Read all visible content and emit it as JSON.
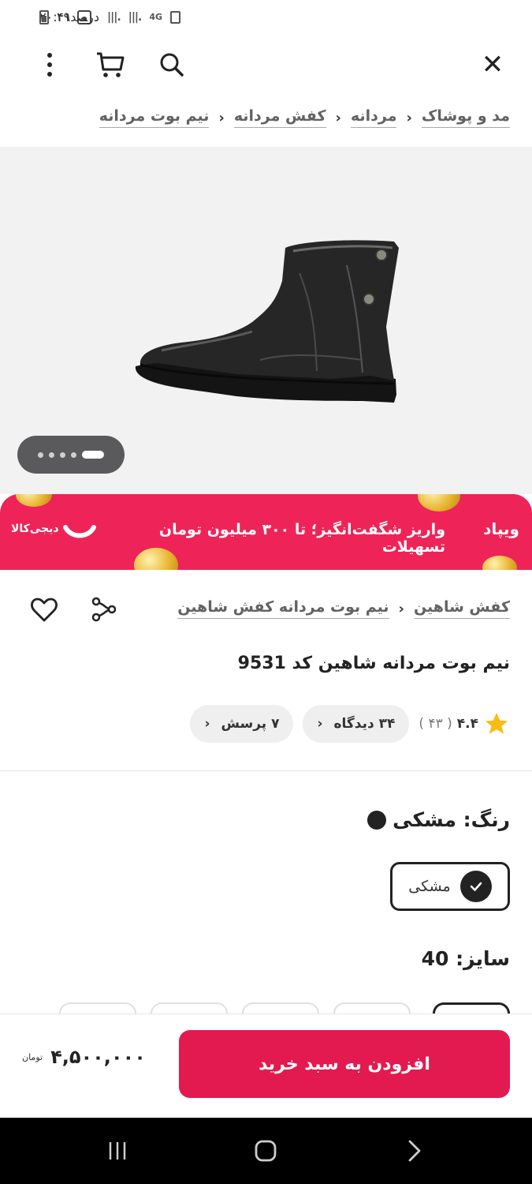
{
  "status_bar": {
    "time": "۲۰:۴۱",
    "battery": "۴۹درصد",
    "network": "4G"
  },
  "top_bar": {
    "close_icon": "close-icon",
    "search_icon": "search-icon",
    "cart_icon": "cart-icon",
    "more_icon": "more-vertical-icon"
  },
  "breadcrumb": {
    "items": [
      "مد و پوشاک",
      "مردانه",
      "کفش مردانه",
      "نیم بوت مردانه"
    ]
  },
  "gallery": {
    "image": "black leather ankle boot",
    "pages": 5,
    "current_page": 1
  },
  "banner": {
    "brand": "ویپاد",
    "text": "واریز شگفت‌انگیز؛ تا ۳۰۰ میلیون تومان تسهیلات",
    "logo_text": "دیجی‌کالا",
    "colors": {
      "background": "#ee2458"
    }
  },
  "brand_crumb": {
    "items": [
      "کفش شاهین",
      "نیم بوت مردانه کفش شاهین"
    ]
  },
  "product": {
    "title": "نیم بوت مردانه شاهین کد 9531",
    "rating": "۴.۴",
    "rating_count": "( ۴۳ )",
    "reviews_label": "۳۴ دیدگاه",
    "questions_label": "۷ پرسش"
  },
  "color": {
    "label": "رنگ: مشکی",
    "options": [
      {
        "name": "مشکی",
        "selected": true,
        "hex": "#222222"
      }
    ]
  },
  "size": {
    "label": "سایز: 40",
    "options_visible": 5,
    "selected_index": 0
  },
  "purchase": {
    "add_to_cart_label": "افزودن به سبد خرید",
    "price": "۴,۵۰۰,۰۰۰",
    "currency": "تومان",
    "button_color": "#e31a4f"
  }
}
